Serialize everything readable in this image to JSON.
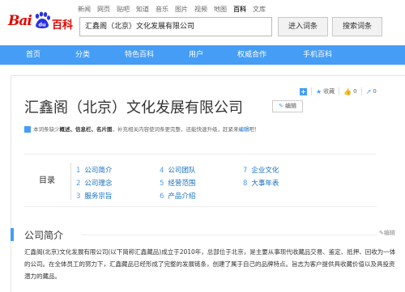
{
  "topnav": [
    "新闻",
    "网页",
    "贴吧",
    "知道",
    "音乐",
    "图片",
    "视频",
    "地图",
    "百科",
    "文库"
  ],
  "topnav_active_index": 8,
  "logo": {
    "bai": "Bai",
    "paw_text": "du",
    "baike": "百科"
  },
  "search": {
    "value": "汇鑫阁（北京）文化发展有限公司",
    "enter_label": "进入词条",
    "search_label": "搜索词条"
  },
  "mainnav": [
    "首页",
    "分类",
    "特色百科",
    "用户",
    "权威合作",
    "手机百科"
  ],
  "tools": {
    "favorite": "收藏",
    "fav_count": "0",
    "like_count": "0",
    "share_count": "0"
  },
  "title": "汇鑫阁（北京）文化发展有限公司",
  "edit_label": "编辑",
  "notice": {
    "prefix": "本词条缺少",
    "missing": "概述、信息栏、名片图",
    "middle": "，补充相关内容使词条更完整，还能快速升级，赶紧来",
    "link": "编辑",
    "suffix": "吧！"
  },
  "catalog": {
    "label": "目录",
    "items": [
      {
        "num": "1",
        "text": "公司简介"
      },
      {
        "num": "2",
        "text": "公司理念"
      },
      {
        "num": "3",
        "text": "服务宗旨"
      },
      {
        "num": "4",
        "text": "公司团队"
      },
      {
        "num": "5",
        "text": "经营范围"
      },
      {
        "num": "6",
        "text": "产品介绍"
      },
      {
        "num": "7",
        "text": "企业文化"
      },
      {
        "num": "8",
        "text": "大事年表"
      }
    ]
  },
  "section": {
    "title": "公司简介",
    "edit": "编辑",
    "text": "汇鑫阁(北京)文化发展有限公司(以下简称汇鑫藏品)成立于2010年，总部位于北京，是主要从事现代收藏品交易、鉴定、抵押、回收为一体的公司。在全体员工的努力下，汇鑫藏品已经形成了完整的发展链条，创建了属于自己的品牌特点。旨志为客户提供具收藏价值以及具投资潜力的藏品。"
  },
  "colors": {
    "accent": "#459df5",
    "brand": "#e10601",
    "link": "#136ec2"
  }
}
